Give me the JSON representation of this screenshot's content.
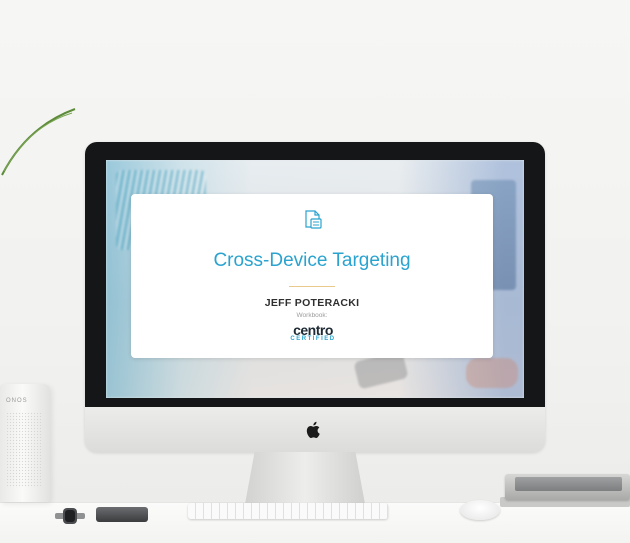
{
  "presentation": {
    "title": "Cross-Device Targeting",
    "author": "JEFF POTERACKI",
    "workbook_label": "Workbook:",
    "brand": {
      "name": "centro",
      "subtitle": "CERTIFIED"
    }
  },
  "speaker": {
    "logo_text": "ONOS"
  },
  "colors": {
    "title_blue": "#2aa3cf",
    "author_dark": "#2f2f2f",
    "divider_gold": "#e9c98c",
    "bezel_black": "#151617"
  },
  "icons": {
    "card_icon": "document-icon",
    "monitor_logo": "apple-logo-icon"
  }
}
